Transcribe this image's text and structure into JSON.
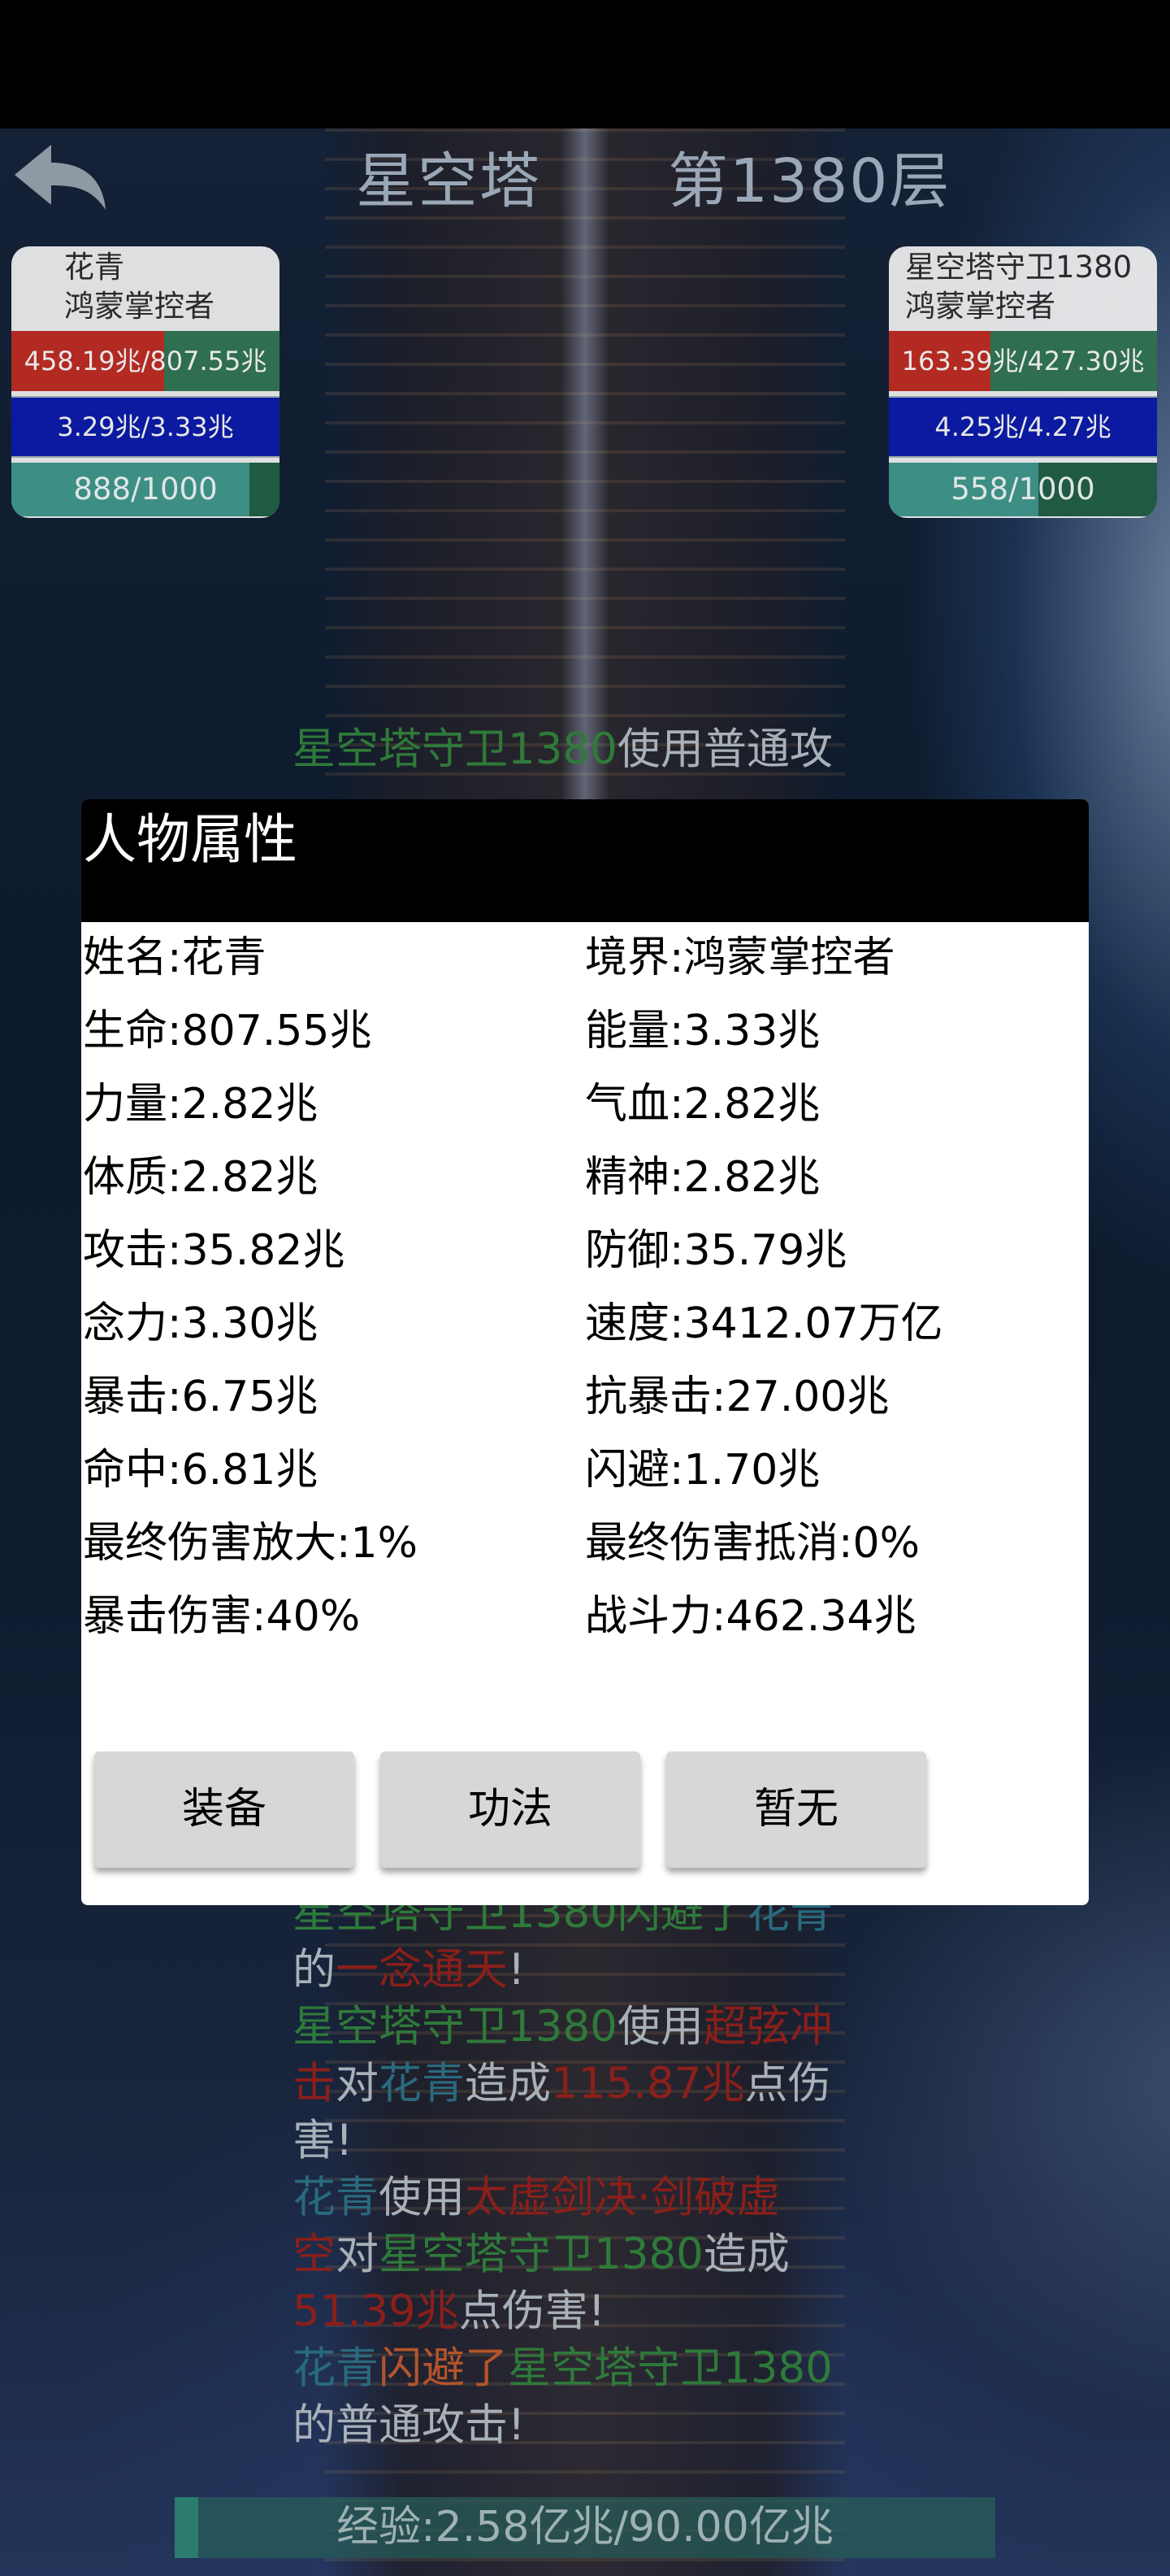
{
  "header": {
    "tower_name": "星空塔",
    "floor": "第1380层"
  },
  "player": {
    "name": "花青",
    "realm": "鸿蒙掌控者",
    "hp": "458.19兆/807.55兆",
    "hp_fraction": 0.57,
    "mp": "3.29兆/3.33兆",
    "energy": "888/1000",
    "energy_fraction": 0.888
  },
  "enemy": {
    "name": "星空塔守卫1380",
    "realm": "鸿蒙掌控者",
    "hp": "163.39兆/427.30兆",
    "hp_fraction": 0.38,
    "mp": "4.25兆/4.27兆",
    "energy": "558/1000",
    "energy_fraction": 0.558
  },
  "log_top": [
    [
      {
        "t": "星空塔守卫1380",
        "c": "green"
      },
      {
        "t": "使用",
        "c": "gray"
      },
      {
        "t": "普通攻",
        "c": "gray"
      }
    ]
  ],
  "log_bottom": [
    [
      {
        "t": "星空塔守卫1380闪避了",
        "c": "green"
      },
      {
        "t": "花青",
        "c": "blue"
      }
    ],
    [
      {
        "t": "的",
        "c": "gray"
      },
      {
        "t": "一念通天",
        "c": "red"
      },
      {
        "t": "!",
        "c": "gray"
      }
    ],
    [
      {
        "t": "星空塔守卫1380",
        "c": "green"
      },
      {
        "t": "使用",
        "c": "gray"
      },
      {
        "t": "超弦冲",
        "c": "red"
      }
    ],
    [
      {
        "t": "击",
        "c": "red"
      },
      {
        "t": "对",
        "c": "gray"
      },
      {
        "t": "花青",
        "c": "blue"
      },
      {
        "t": "造成",
        "c": "gray"
      },
      {
        "t": "115.87兆",
        "c": "red"
      },
      {
        "t": "点伤",
        "c": "gray"
      }
    ],
    [
      {
        "t": "害!",
        "c": "gray"
      }
    ],
    [
      {
        "t": "花青",
        "c": "blue"
      },
      {
        "t": "使用",
        "c": "gray"
      },
      {
        "t": "太虚剑决·剑破虚",
        "c": "red"
      }
    ],
    [
      {
        "t": "空",
        "c": "red"
      },
      {
        "t": "对",
        "c": "gray"
      },
      {
        "t": "星空塔守卫1380",
        "c": "green"
      },
      {
        "t": "造成",
        "c": "gray"
      }
    ],
    [
      {
        "t": "51.39兆",
        "c": "red"
      },
      {
        "t": "点伤害!",
        "c": "gray"
      }
    ],
    [
      {
        "t": "花青",
        "c": "blue"
      },
      {
        "t": "闪避了",
        "c": "orange"
      },
      {
        "t": "星空塔守卫1380",
        "c": "green"
      }
    ],
    [
      {
        "t": "的普通攻击!",
        "c": "gray"
      }
    ]
  ],
  "modal": {
    "title": "人物属性",
    "attributes": [
      [
        "姓名:花青",
        "境界:鸿蒙掌控者"
      ],
      [
        "生命:807.55兆",
        "能量:3.33兆"
      ],
      [
        "力量:2.82兆",
        "气血:2.82兆"
      ],
      [
        "体质:2.82兆",
        "精神:2.82兆"
      ],
      [
        "攻击:35.82兆",
        "防御:35.79兆"
      ],
      [
        "念力:3.30兆",
        "速度:3412.07万亿"
      ],
      [
        "暴击:6.75兆",
        "抗暴击:27.00兆"
      ],
      [
        "命中:6.81兆",
        "闪避:1.70兆"
      ],
      [
        "最终伤害放大:1%",
        "最终伤害抵消:0%"
      ],
      [
        "暴击伤害:40%",
        "战斗力:462.34兆"
      ]
    ],
    "buttons": {
      "equipment": "装备",
      "skills": "功法",
      "none": "暂无"
    }
  },
  "experience": {
    "label": "经验:2.58亿兆/90.00亿兆",
    "fraction": 0.029
  },
  "colors": {
    "green": "#2f7a3a",
    "gray": "#a8b0b8",
    "red": "#8b1f1a",
    "blue": "#2a6a7e",
    "orange": "#b5542a"
  }
}
